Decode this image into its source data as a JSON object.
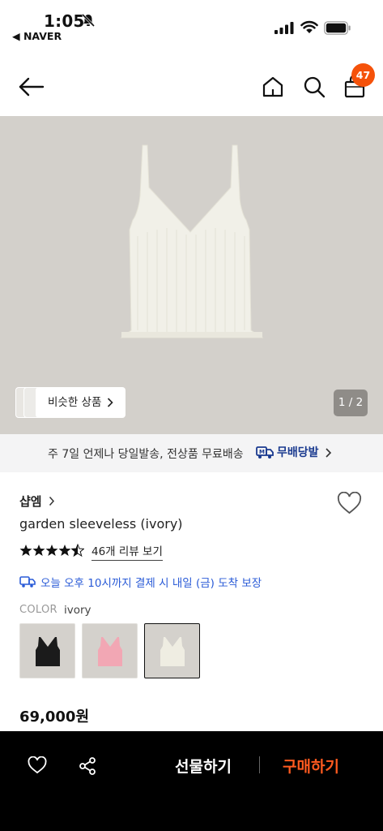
{
  "status_bar": {
    "time": "1:05",
    "back_app": "◀ NAVER"
  },
  "header": {
    "cart_count": "47",
    "icons": [
      "arrow-left-icon",
      "home-icon",
      "search-icon",
      "shopping-bag-icon"
    ]
  },
  "hero": {
    "similar_label": "비슷한 상품",
    "pager": "1 / 2"
  },
  "shipping_banner": {
    "text": "주 7일 언제나 당일발송, 전상품 무료배송",
    "brand": "무배당발"
  },
  "product": {
    "shop_name": "샵엠",
    "name": "garden sleeveless (ivory)",
    "rating": 4.5,
    "review_link": "46개 리뷰 보기",
    "delivery_text": "오늘 오후 10시까지 결제 시 내일 (금) 도착 보장",
    "color_label": "COLOR",
    "color_value": "ivory",
    "color_options": [
      {
        "name": "black",
        "swatch": "#1b1b1b"
      },
      {
        "name": "pink",
        "swatch": "#f2a7b4"
      },
      {
        "name": "ivory",
        "swatch": "#efede2",
        "selected": true
      }
    ],
    "price": "69,000원"
  },
  "bottom_bar": {
    "gift_label": "선물하기",
    "buy_label": "구매하기",
    "buy_color": "#ff5a1f"
  },
  "colors": {
    "badge": "#f5520a",
    "hero_bg": "#d3d0cb",
    "link_blue": "#2a5bd7"
  }
}
